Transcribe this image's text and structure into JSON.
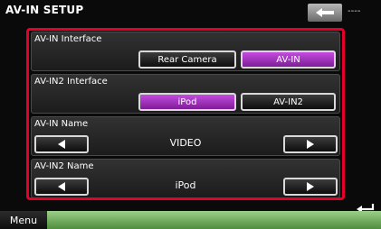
{
  "header": {
    "title": "AV-IN SETUP",
    "status_text": "----"
  },
  "sections": {
    "av_in_interface": {
      "label": "AV-IN Interface",
      "options": [
        "Rear Camera",
        "AV-IN"
      ],
      "selected": "AV-IN"
    },
    "av_in2_interface": {
      "label": "AV-IN2 Interface",
      "options": [
        "iPod",
        "AV-IN2"
      ],
      "selected": "iPod"
    },
    "av_in_name": {
      "label": "AV-IN Name",
      "value": "VIDEO"
    },
    "av_in2_name": {
      "label": "AV-IN2 Name",
      "value": "iPod"
    }
  },
  "footer": {
    "menu_label": "Menu"
  },
  "icons": {
    "back": "back-arrow-icon",
    "prev": "left-triangle-icon",
    "next": "right-triangle-icon",
    "return": "return-icon"
  },
  "colors": {
    "accent": "#e5002b",
    "selected": "#a43cc4",
    "footer": "#6fa85c"
  }
}
